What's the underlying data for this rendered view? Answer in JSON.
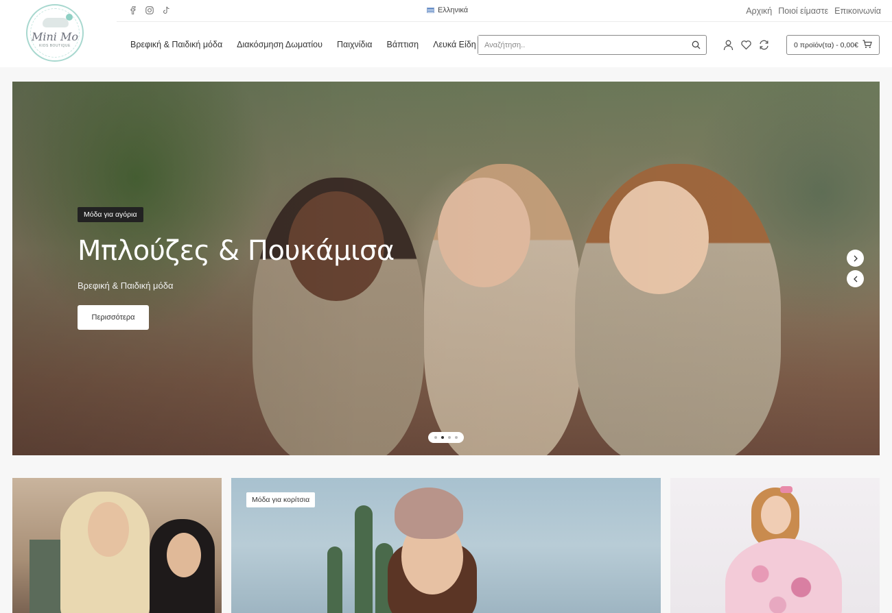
{
  "logo": {
    "name": "Mini Mo",
    "tagline": "KIDS BOUTIQUE"
  },
  "topbar": {
    "social": [
      "facebook-icon",
      "instagram-icon",
      "tiktok-icon"
    ],
    "language": "Ελληνικά",
    "links": [
      "Αρχική",
      "Ποιοί είμαστε",
      "Επικοινωνία"
    ]
  },
  "nav": {
    "items": [
      "Βρεφική & Παιδική μόδα",
      "Διακόσμηση Δωματίου",
      "Παιχνίδια",
      "Βάπτιση",
      "Λευκά Είδη"
    ]
  },
  "search": {
    "placeholder": "Αναζήτηση..",
    "value": ""
  },
  "header_icons": [
    "user-icon",
    "heart-icon",
    "compare-icon"
  ],
  "cart": {
    "label": "0 προϊόν(τα) - 0,00€"
  },
  "hero": {
    "badge": "Μόδα για αγόρια",
    "title": "Μπλούζες & Πουκάμισα",
    "subtitle": "Βρεφική & Παιδική μόδα",
    "button": "Περισσότερα",
    "slides_total": 4,
    "active_slide": 2
  },
  "banners": [
    {
      "badge": ""
    },
    {
      "badge": "Μόδα για κορίτσια"
    },
    {
      "badge": ""
    }
  ],
  "colors": {
    "accent": "#8fd0c4",
    "text": "#333333",
    "badge_bg": "#222222"
  }
}
